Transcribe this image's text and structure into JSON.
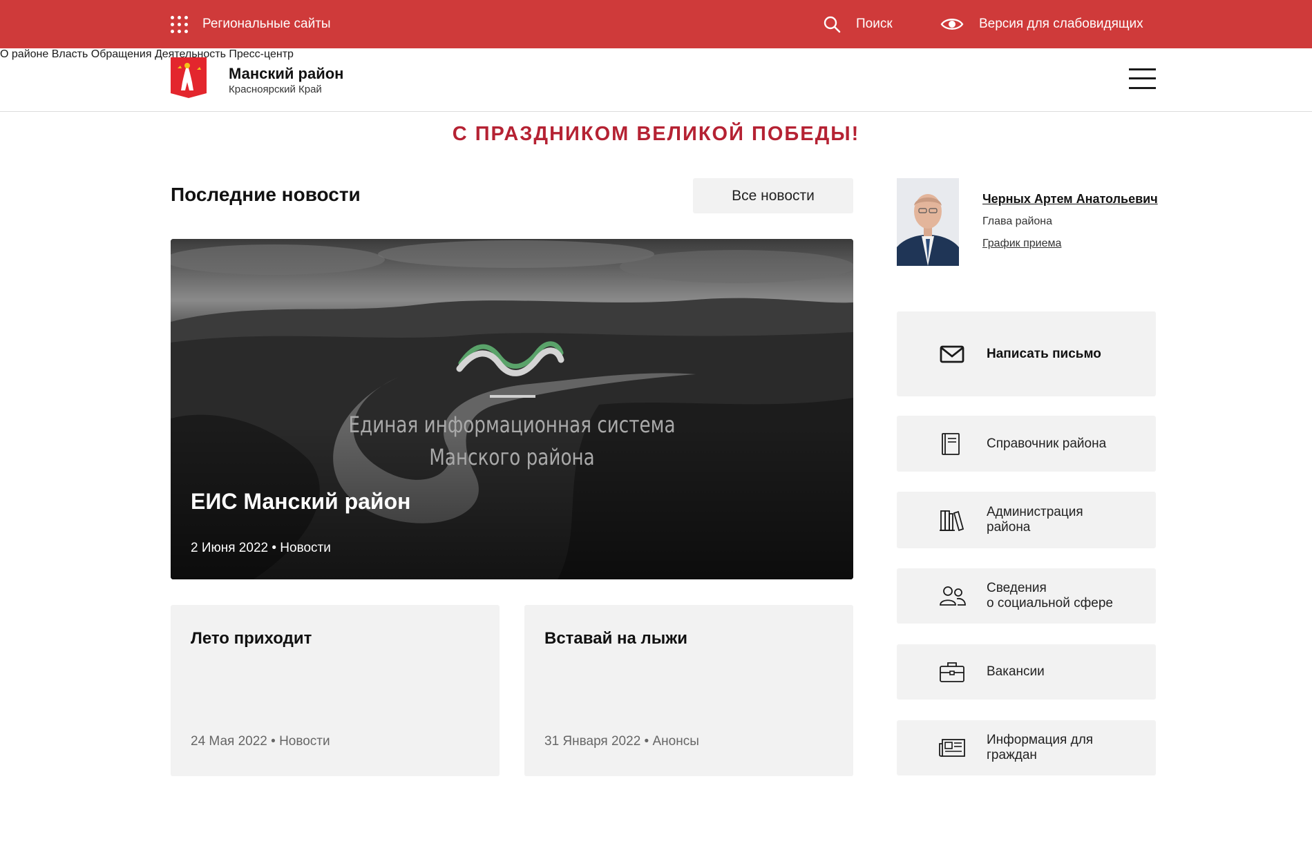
{
  "topbar": {
    "regional_label": "Региональные сайты",
    "search_label": "Поиск",
    "vision_label": "Версия для слабовидящих",
    "background": "#cf3a3a"
  },
  "header": {
    "title": "Манский район",
    "subtitle": "Красноярский Край",
    "nav": [
      "О районе",
      "Власть",
      "Обращения",
      "Деятельность",
      "Пресс-центр"
    ]
  },
  "banner": "С ПРАЗДНИКОМ ВЕЛИКОЙ ПОБЕДЫ!",
  "news": {
    "section_title": "Последние новости",
    "all_news_label": "Все новости",
    "featured": {
      "image_caption_line1": "Единая информационная система",
      "image_caption_line2": "Манского района",
      "title": "ЕИС Манский район",
      "meta": "2 Июня 2022 • Новости"
    },
    "cards": [
      {
        "title": "Лето приходит",
        "meta": "24 Мая 2022 • Новости"
      },
      {
        "title": "Вставай на лыжи",
        "meta": "31 Января 2022 • Анонсы"
      }
    ]
  },
  "head": {
    "name": "Черных Артем Анатольевич",
    "role": "Глава района",
    "schedule_link": "График приема"
  },
  "side_links": [
    {
      "label": "Написать письмо",
      "icon": "envelope-icon"
    },
    {
      "label": "Справочник района",
      "icon": "book-icon"
    },
    {
      "label": "Администрация\nрайона",
      "icon": "library-icon"
    },
    {
      "label": "Сведения\nо социальной сфере",
      "icon": "users-icon"
    },
    {
      "label": "Вакансии",
      "icon": "briefcase-icon"
    },
    {
      "label": "Информация для\nграждан",
      "icon": "newspaper-icon"
    }
  ],
  "colors": {
    "accent_red": "#cf3a3a",
    "banner_red": "#b52233",
    "card_bg": "#f2f2f2"
  }
}
